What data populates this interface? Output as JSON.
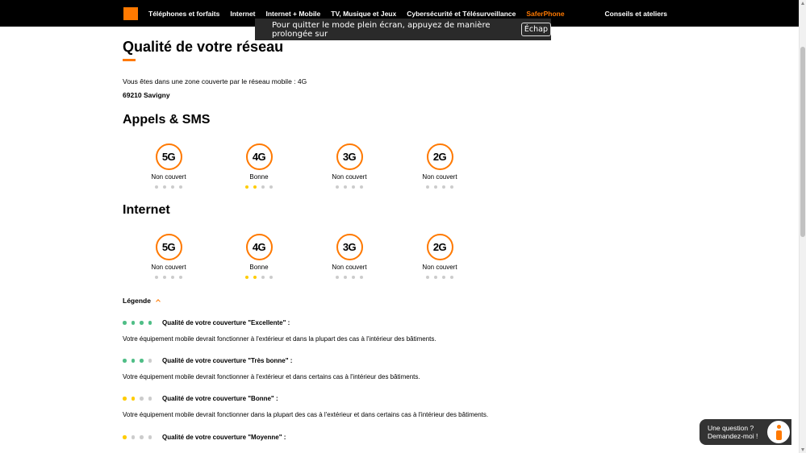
{
  "nav": {
    "items": [
      {
        "label": "Téléphones et forfaits"
      },
      {
        "label": "Internet"
      },
      {
        "label": "Internet + Mobile"
      },
      {
        "label": "TV, Musique et Jeux"
      },
      {
        "label": "Cybersécurité et Télésurveillance"
      },
      {
        "label": "SaferPhone"
      }
    ],
    "right_label": "Conseils et ateliers",
    "accent_color": "#ff7900"
  },
  "fullscreen_notice": {
    "text": "Pour quitter le mode plein écran, appuyez de manière prolongée sur",
    "key": "Échap"
  },
  "page": {
    "title": "Qualité de votre réseau",
    "coverage_text": "Vous êtes dans une zone couverte par le réseau mobile : 4G",
    "location": "69210 Savigny"
  },
  "sections": [
    {
      "title": "Appels & SMS",
      "techs": [
        {
          "name": "5G",
          "status": "Non couvert",
          "level": 0
        },
        {
          "name": "4G",
          "status": "Bonne",
          "level": 2
        },
        {
          "name": "3G",
          "status": "Non couvert",
          "level": 0
        },
        {
          "name": "2G",
          "status": "Non couvert",
          "level": 0
        }
      ]
    },
    {
      "title": "Internet",
      "techs": [
        {
          "name": "5G",
          "status": "Non couvert",
          "level": 0
        },
        {
          "name": "4G",
          "status": "Bonne",
          "level": 2
        },
        {
          "name": "3G",
          "status": "Non couvert",
          "level": 0
        },
        {
          "name": "2G",
          "status": "Non couvert",
          "level": 0
        }
      ]
    }
  ],
  "legend": {
    "toggle_label": "Légende",
    "entries": [
      {
        "label": "Qualité de votre couverture \"Excellente\" :",
        "description": "Votre équipement mobile devrait fonctionner à l'extérieur et dans la plupart des cas à l'intérieur des bâtiments.",
        "level": 4,
        "color": "green"
      },
      {
        "label": "Qualité de votre couverture \"Très bonne\" :",
        "description": "Votre équipement mobile devrait fonctionner à l'extérieur et dans certains cas à l'intérieur des bâtiments.",
        "level": 3,
        "color": "green"
      },
      {
        "label": "Qualité de votre couverture \"Bonne\" :",
        "description": "Votre équipement mobile devrait fonctionner dans la plupart des cas à l'extérieur et dans certains cas à l'intérieur des bâtiments.",
        "level": 2,
        "color": "yellow"
      },
      {
        "label": "Qualité de votre couverture \"Moyenne\" :",
        "description": "",
        "level": 1,
        "color": "yellow"
      }
    ]
  },
  "chat": {
    "line1": "Une question ?",
    "line2": "Demandez-moi !"
  }
}
